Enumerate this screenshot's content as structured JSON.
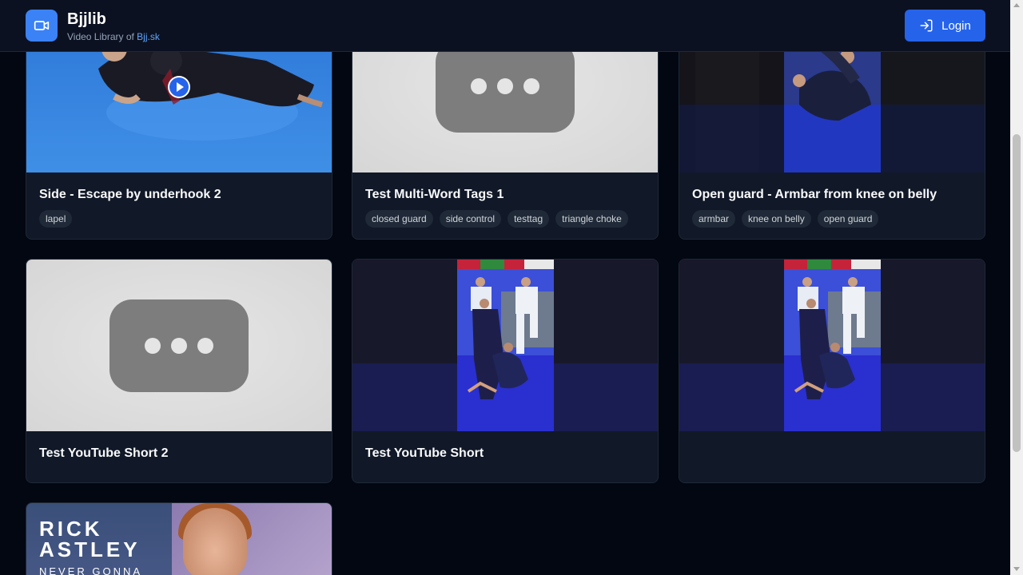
{
  "header": {
    "brand": "Bjjlib",
    "subtitle_prefix": "Video Library of ",
    "subtitle_link": "Bjj.sk",
    "login_label": "Login"
  },
  "colors": {
    "accent": "#2563eb",
    "logo": "#3b82f6",
    "background": "#030712",
    "card": "#111827"
  },
  "videos": [
    {
      "title": "Side - Escape by underhook 2",
      "tags": [
        "lapel"
      ],
      "thumbnail": "bjj-mat-photo"
    },
    {
      "title": "Test Multi-Word Tags 1",
      "tags": [
        "closed guard",
        "side control",
        "testtag",
        "triangle choke"
      ],
      "thumbnail": "youtube-placeholder"
    },
    {
      "title": "Open guard - Armbar from knee on belly",
      "tags": [
        "armbar",
        "knee on belly",
        "open guard"
      ],
      "thumbnail": "vertical-video-dark"
    },
    {
      "title": "Test YouTube Short 2",
      "tags": [],
      "thumbnail": "youtube-placeholder"
    },
    {
      "title": "Test YouTube Short",
      "tags": [],
      "thumbnail": "vertical-video-gym"
    },
    {
      "title": "",
      "tags": [],
      "thumbnail": "vertical-video-gym"
    },
    {
      "title": "",
      "tags": [],
      "thumbnail": "rick-astley",
      "thumb_text": [
        "RICK",
        "ASTLEY",
        "NEVER GONNA"
      ]
    }
  ]
}
